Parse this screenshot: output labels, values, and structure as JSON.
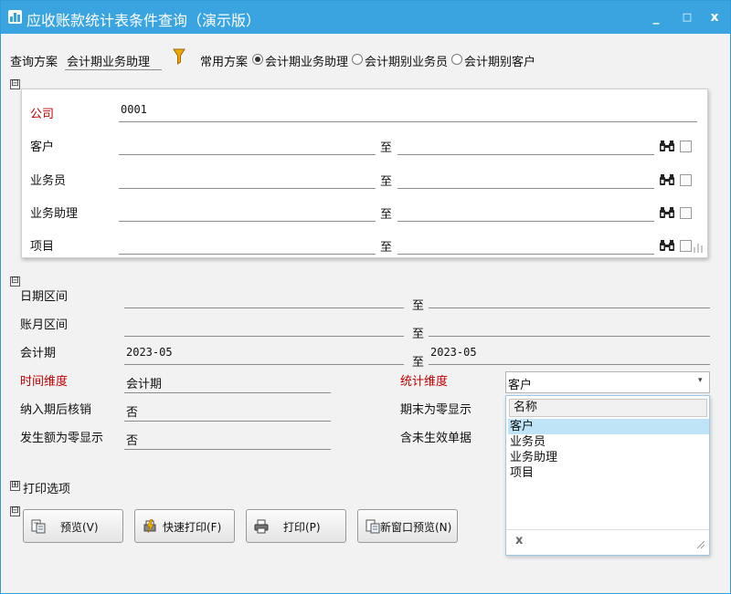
{
  "window": {
    "title": "应收账款统计表条件查询（演示版）",
    "min_glyph": "_",
    "max_glyph": "□",
    "close_glyph": "x",
    "accent": "#3aa4e0"
  },
  "query_scheme": {
    "label": "查询方案",
    "value": "会计期业务助理",
    "common_label": "常用方案",
    "options": [
      "会计期业务助理",
      "会计期别业务员",
      "会计期别客户"
    ],
    "selected_index": 0
  },
  "section_toggle": "⊟",
  "filters": {
    "company_label": "公司",
    "company_value": "0001",
    "to_label": "至",
    "rows": [
      {
        "label": "客户"
      },
      {
        "label": "业务员"
      },
      {
        "label": "业务助理"
      },
      {
        "label": "项目"
      }
    ]
  },
  "period": {
    "date_range_label": "日期区间",
    "account_month_label": "账月区间",
    "accounting_period_label": "会计期",
    "period_from": "2023-05",
    "period_to": "2023-05",
    "to_label": "至",
    "time_dim_label": "时间维度",
    "time_dim_value": "会计期",
    "include_later_label": "纳入期后核销",
    "include_later_value": "否",
    "zero_amount_label": "发生额为零显示",
    "zero_amount_value": "否",
    "stat_dim_label": "统计维度",
    "period_end_zero_label": "期末为零显示",
    "unposted_label": "含未生效单据"
  },
  "stat_dropdown": {
    "selected": "客户",
    "header": "名称",
    "options": [
      "客户",
      "业务员",
      "业务助理",
      "项目"
    ],
    "highlight_index": 0,
    "clear_glyph": "x"
  },
  "print_options": {
    "toggle": "⊞",
    "label": "打印选项"
  },
  "actions": {
    "preview": "预览(V)",
    "quick_print": "快速打印(F)",
    "print": "打印(P)",
    "new_window_preview": "新窗口预览(N)"
  }
}
